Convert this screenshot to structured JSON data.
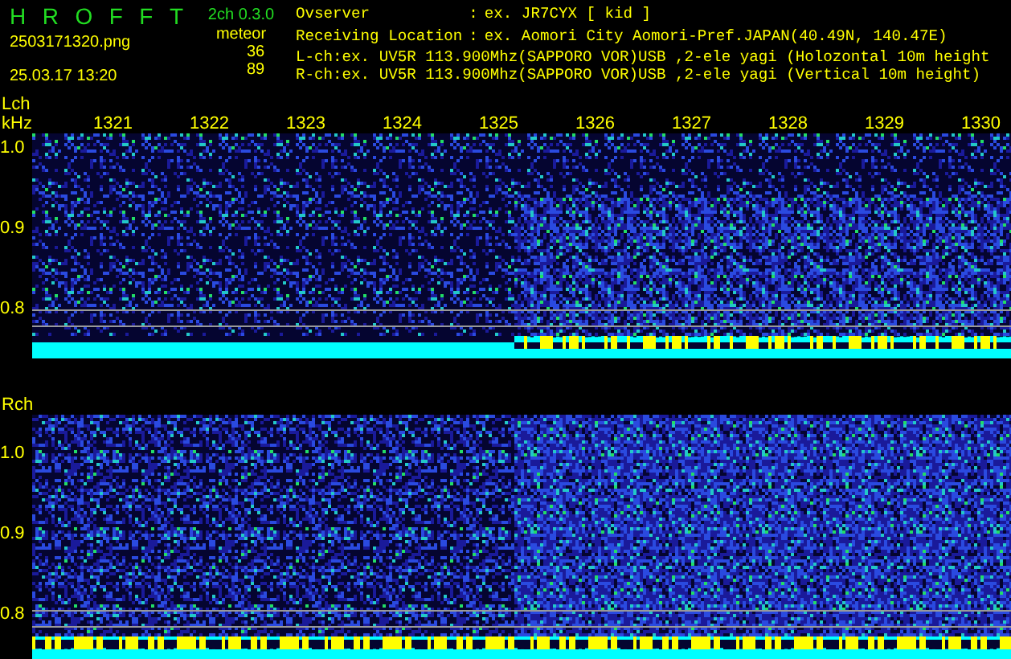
{
  "header": {
    "title_letters": [
      "H",
      "R",
      "O",
      "F",
      "F",
      "T"
    ],
    "version": "2ch 0.3.0",
    "filename": "2503171320.png",
    "datetime": "25.03.17 13:20",
    "meteor_label": "meteor",
    "meteor_counts": [
      "36",
      "89"
    ],
    "info": [
      {
        "kind": "field",
        "label": "Ovserver",
        "sep": ":",
        "value": "ex. JR7CYX [ kid ]"
      },
      {
        "kind": "field",
        "label": "Receiving Location",
        "sep": ":",
        "value": "ex. Aomori City Aomori-Pref.JAPAN(40.49N, 140.47E)"
      },
      {
        "kind": "line",
        "text": "L-ch:ex. UV5R 113.900Mhz(SAPPORO VOR)USB ,2-ele yagi (Holozontal 10m height"
      },
      {
        "kind": "line",
        "text": "R-ch:ex. UV5R 113.900Mhz(SAPPORO VOR)USB ,2-ele yagi (Vertical 10m height)"
      }
    ]
  },
  "channels": [
    {
      "label": "Lch",
      "unit": "kHz",
      "time_ticks": [
        "1321",
        "1322",
        "1323",
        "1324",
        "1325",
        "1326",
        "1327",
        "1328",
        "1329",
        "1330"
      ],
      "y_ticks": [
        "1.0",
        "0.9",
        "0.8"
      ]
    },
    {
      "label": "Rch",
      "y_ticks": [
        "1.0",
        "0.9",
        "0.8"
      ]
    }
  ]
}
